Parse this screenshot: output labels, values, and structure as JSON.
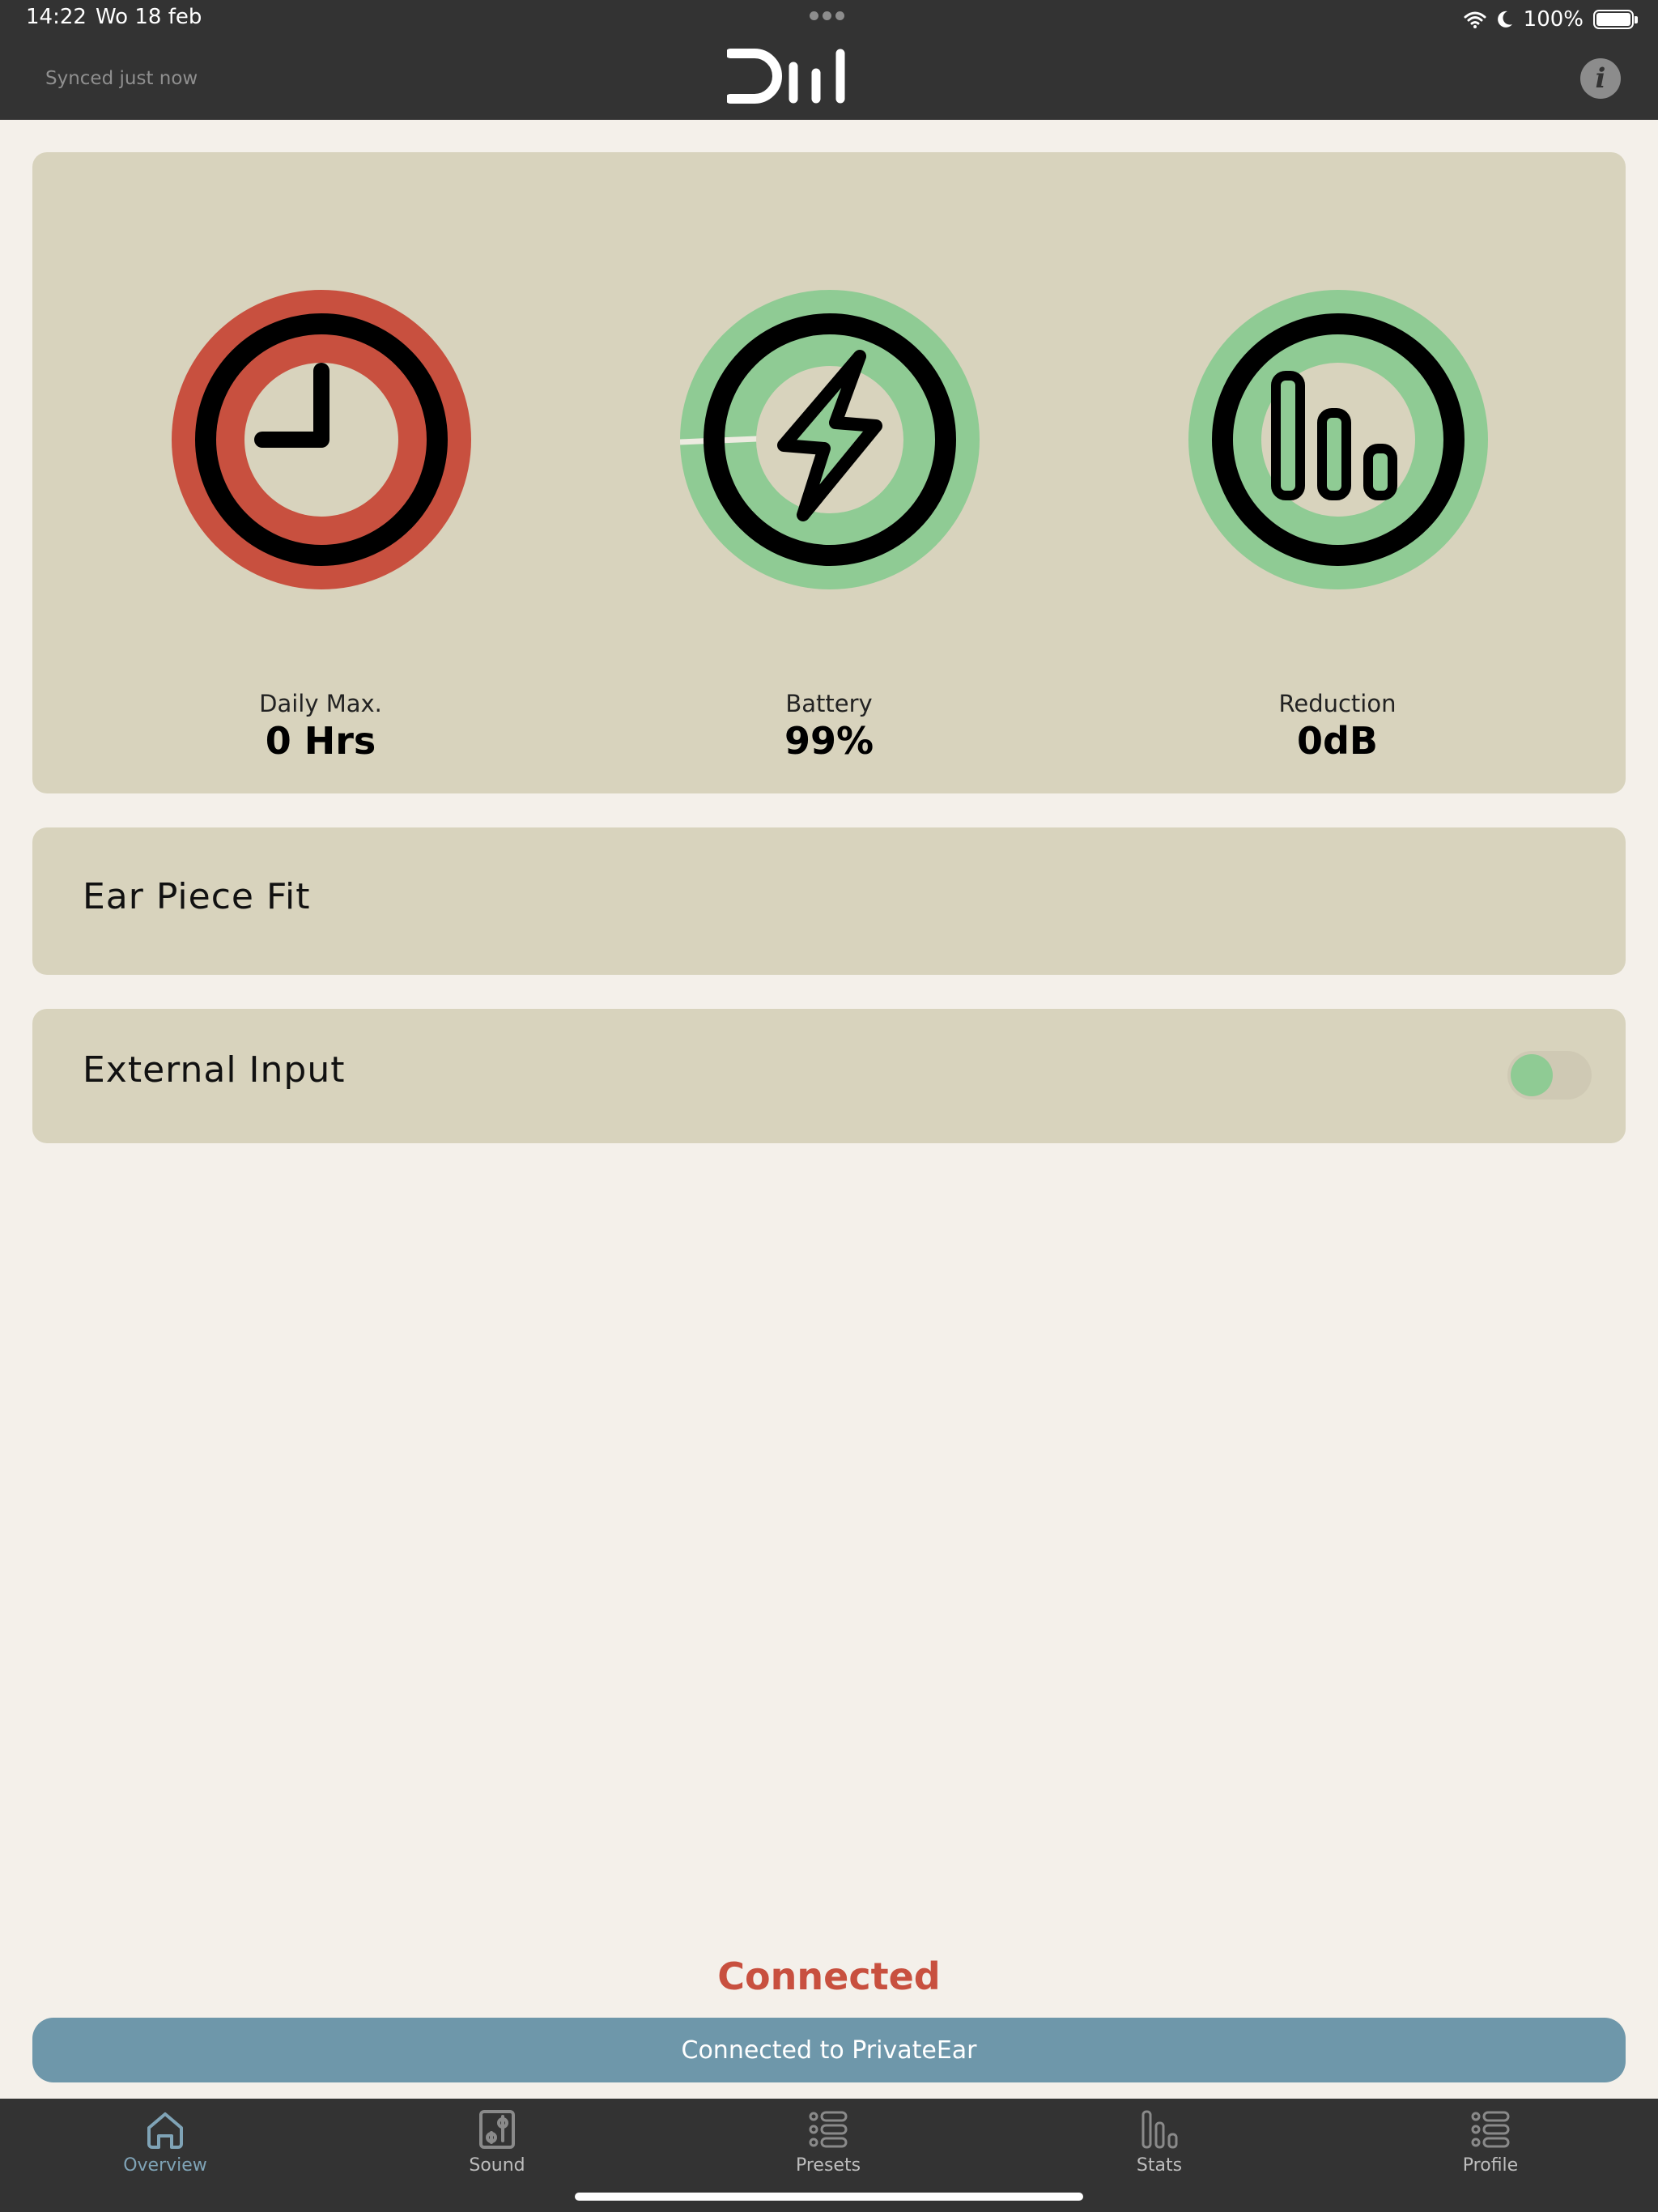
{
  "status_bar": {
    "time": "14:22",
    "date": "Wo 18 feb",
    "battery_text": "100%",
    "battery_level_pct": 100
  },
  "header": {
    "sync_text": "Synced just now",
    "info_label": "i"
  },
  "stats": {
    "daily_max": {
      "label": "Daily Max.",
      "value": "0 Hrs"
    },
    "battery": {
      "label": "Battery",
      "value": "99%",
      "level_pct": 99
    },
    "reduction": {
      "label": "Reduction",
      "value": "0dB"
    }
  },
  "cards": {
    "ear_piece_fit": {
      "title": "Ear Piece Fit"
    },
    "external_input": {
      "title": "External Input",
      "enabled": false
    }
  },
  "connection": {
    "status": "Connected",
    "button": "Connected to PrivateEar"
  },
  "tabs": [
    {
      "label": "Overview",
      "icon": "home-icon",
      "active": true
    },
    {
      "label": "Sound",
      "icon": "sliders-icon",
      "active": false
    },
    {
      "label": "Presets",
      "icon": "list-icon",
      "active": false
    },
    {
      "label": "Stats",
      "icon": "bars-icon",
      "active": false
    },
    {
      "label": "Profile",
      "icon": "list-icon",
      "active": false
    }
  ],
  "colors": {
    "red": "#C8503F",
    "green": "#8FCB94",
    "card": "#D8D3BD",
    "accent_blue": "#6E97AA",
    "dark": "#333333"
  }
}
